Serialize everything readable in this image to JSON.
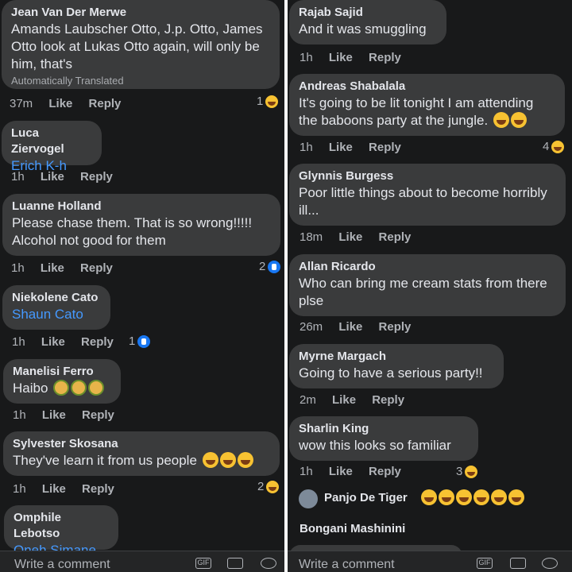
{
  "left": {
    "comments": [
      {
        "author": "Jean Van Der Merwe",
        "text": "Amands Laubscher Otto, J.p. Otto, James Otto look at Lukas Otto again, will only be him, that's",
        "translated": "Automatically Translated",
        "time": "37m",
        "like": "Like",
        "reply": "Reply",
        "react_count": "1",
        "react_icon": "laugh-icon"
      },
      {
        "author": "Luca Ziervogel",
        "mention": "Erich K-h",
        "time": "1h",
        "like": "Like",
        "reply": "Reply"
      },
      {
        "author": "Luanne Holland",
        "text": "Please chase them. That is so wrong!!!!! Alcohol not good for them",
        "time": "1h",
        "like": "Like",
        "reply": "Reply",
        "react_count": "2",
        "react_icon": "like-icon"
      },
      {
        "author": "Niekolene Cato",
        "mention": "Shaun Cato",
        "time": "1h",
        "like": "Like",
        "reply": "Reply",
        "react_count": "1",
        "react_icon": "like-icon"
      },
      {
        "author": "Manelisi Ferro",
        "text": "Haibo",
        "emojis": [
          "person-icon",
          "person-icon",
          "person-icon"
        ],
        "time": "1h",
        "like": "Like",
        "reply": "Reply"
      },
      {
        "author": "Sylvester Skosana",
        "text": "They've learn it from us people",
        "emojis": [
          "tears-of-joy-icon",
          "tears-of-joy-icon",
          "tears-of-joy-icon"
        ],
        "time": "1h",
        "like": "Like",
        "reply": "Reply",
        "react_count": "2",
        "react_icon": "laugh-icon"
      },
      {
        "author": "Omphile Lebotso",
        "mention": "Oneh Simane"
      }
    ],
    "composer": {
      "placeholder": "Write a comment",
      "gif": "GIF"
    }
  },
  "right": {
    "comments": [
      {
        "author": "Rajab Sajid",
        "text": "And it was smuggling",
        "time": "1h",
        "like": "Like",
        "reply": "Reply"
      },
      {
        "author": "Andreas Shabalala",
        "text": "It's going to be lit tonight I am attending the baboons party at the jungle.",
        "emojis": [
          "tears-of-joy-icon",
          "tears-of-joy-icon"
        ],
        "time": "1h",
        "like": "Like",
        "reply": "Reply",
        "react_count": "4",
        "react_icon": "laugh-icon"
      },
      {
        "author": "Glynnis Burgess",
        "text": "Poor little things about to become horribly ill...",
        "time": "18m",
        "like": "Like",
        "reply": "Reply"
      },
      {
        "author": "Allan Ricardo",
        "text": "Who can bring me cream stats from there plse",
        "time": "26m",
        "like": "Like",
        "reply": "Reply"
      },
      {
        "author": "Myrne Margach",
        "text": "Going to have a serious party!!",
        "time": "2m",
        "like": "Like",
        "reply": "Reply"
      },
      {
        "author": "Sharlin King",
        "text": "wow this looks so familiar",
        "time": "1h",
        "like": "Like",
        "reply": "Reply",
        "react_count": "3",
        "react_icon": "laugh-icon"
      }
    ],
    "reply_preview": {
      "author": "Panjo De Tiger",
      "emojis": [
        "tears-of-joy-icon",
        "tears-of-joy-icon",
        "tears-of-joy-icon",
        "tears-of-joy-icon",
        "tears-of-joy-icon",
        "tears-of-joy-icon"
      ]
    },
    "last_author": "Bongani Mashinini",
    "composer": {
      "placeholder": "Write a comment",
      "gif": "GIF"
    }
  }
}
